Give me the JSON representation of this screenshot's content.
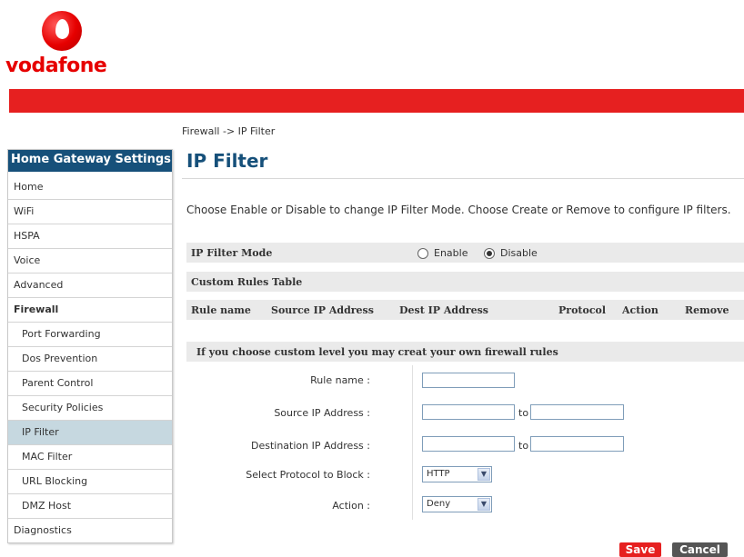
{
  "brand": {
    "name": "vodafone",
    "color": "#e60000",
    "logo_icon": "vodafone-speech-mark-icon"
  },
  "breadcrumb": "Firewall -> IP Filter",
  "sidebar": {
    "title": "Home Gateway Settings",
    "items": [
      {
        "label": "Home",
        "level": 1
      },
      {
        "label": "WiFi",
        "level": 1
      },
      {
        "label": "HSPA",
        "level": 1
      },
      {
        "label": "Voice",
        "level": 1
      },
      {
        "label": "Advanced",
        "level": 1
      },
      {
        "label": "Firewall",
        "level": 1
      },
      {
        "label": "Port Forwarding",
        "level": 2
      },
      {
        "label": "Dos Prevention",
        "level": 2
      },
      {
        "label": "Parent Control",
        "level": 2
      },
      {
        "label": "Security Policies",
        "level": 2
      },
      {
        "label": "IP Filter",
        "level": 2,
        "selected": true
      },
      {
        "label": "MAC Filter",
        "level": 2
      },
      {
        "label": "URL Blocking",
        "level": 2
      },
      {
        "label": "DMZ Host",
        "level": 2
      },
      {
        "label": "Diagnostics",
        "level": 1
      }
    ]
  },
  "page": {
    "title": "IP Filter",
    "description": "Choose Enable or Disable to change IP Filter Mode. Choose Create or Remove to configure IP filters.",
    "mode": {
      "label": "IP Filter Mode",
      "options": [
        "Enable",
        "Disable"
      ],
      "selected": "Disable"
    },
    "custom_rules_title": "Custom Rules Table",
    "table_headers": [
      "Rule name",
      "Source IP Address",
      "Dest IP Address",
      "Protocol",
      "Action",
      "Remove"
    ],
    "custom_level_title": "If you choose custom level you may creat your own firewall rules",
    "form": {
      "rule_name_label": "Rule name :",
      "rule_name_value": "",
      "source_ip_label": "Source IP Address :",
      "source_ip_from": "",
      "source_ip_to": "",
      "dest_ip_label": "Destination IP Address :",
      "dest_ip_from": "",
      "dest_ip_to": "",
      "to_label": "to",
      "protocol_label": "Select Protocol to Block :",
      "protocol_value": "HTTP",
      "action_label": "Action :",
      "action_value": "Deny"
    },
    "buttons": {
      "save": "Save",
      "cancel": "Cancel"
    }
  },
  "colors": {
    "red_bar": "#e62020",
    "nav_header": "#16507a",
    "title": "#16507a",
    "selected_item": "#c6d8e0"
  }
}
